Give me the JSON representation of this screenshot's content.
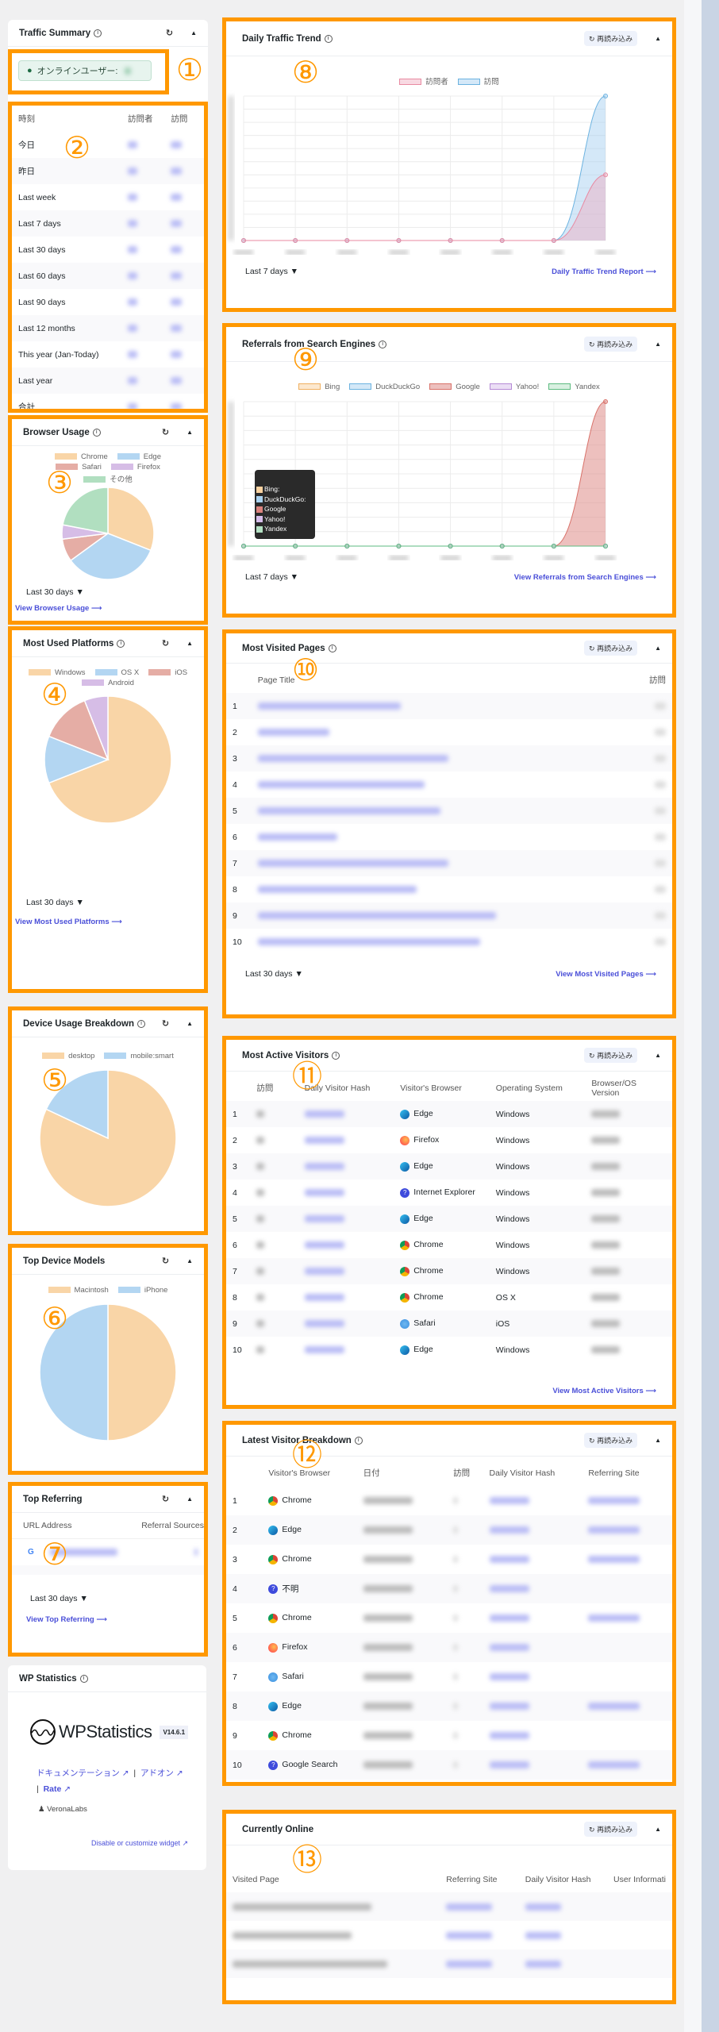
{
  "annotations": [
    "①",
    "②",
    "③",
    "④",
    "⑤",
    "⑥",
    "⑦",
    "⑧",
    "⑨",
    "⑩",
    "⑪",
    "⑫",
    "⑬"
  ],
  "reload_label": "再読み込み",
  "colors": {
    "annotation": "#ff9800",
    "link": "#4a4fd8",
    "chrome": "#f9d5a7",
    "edge": "#b3d6f2",
    "safari": "#e5ada5",
    "firefox": "#d6bde6",
    "other": "#b1dfc0"
  },
  "traffic_summary": {
    "title": "Traffic Summary",
    "online_label": "オンラインユーザー:",
    "columns": [
      "時刻",
      "訪問者",
      "訪問"
    ],
    "rows": [
      "今日",
      "昨日",
      "Last week",
      "Last 7 days",
      "Last 30 days",
      "Last 60 days",
      "Last 90 days",
      "Last 12 months",
      "This year (Jan-Today)",
      "Last year",
      "合計"
    ]
  },
  "browser_usage": {
    "title": "Browser Usage",
    "range": "Last 30 days",
    "link": "View Browser Usage"
  },
  "platforms": {
    "title": "Most Used Platforms",
    "range": "Last 30 days",
    "link": "View Most Used Platforms"
  },
  "device_usage": {
    "title": "Device Usage Breakdown"
  },
  "device_models": {
    "title": "Top Device Models"
  },
  "top_referring": {
    "title": "Top Referring",
    "columns": [
      "URL Address",
      "Referral Sources"
    ],
    "range": "Last 30 days",
    "link": "View Top Referring"
  },
  "wp_statistics": {
    "title": "WP Statistics",
    "logo": "WPStatistics",
    "version": "V14.6.1",
    "links": [
      "ドキュメンテーション",
      "アドオン",
      "Rate"
    ],
    "author": "VeronaLabs",
    "customize": "Disable or customize widget"
  },
  "daily_trend": {
    "title": "Daily Traffic Trend",
    "range": "Last 7 days",
    "link": "Daily Traffic Trend Report"
  },
  "search_engines": {
    "title": "Referrals from Search Engines",
    "range": "Last 7 days",
    "link": "View Referrals from Search Engines",
    "tooltip": [
      "Bing:",
      "DuckDuckGo:",
      "Google",
      "Yahoo!",
      "Yandex"
    ]
  },
  "most_visited": {
    "title": "Most Visited Pages",
    "columns": [
      "",
      "Page Title",
      "訪問"
    ],
    "rows": [
      "1",
      "2",
      "3",
      "4",
      "5",
      "6",
      "7",
      "8",
      "9",
      "10"
    ],
    "range": "Last 30 days",
    "link": "View Most Visited Pages"
  },
  "most_active": {
    "title": "Most Active Visitors",
    "columns": [
      "",
      "訪問",
      "Daily Visitor Hash",
      "Visitor's Browser",
      "Operating System",
      "Browser/OS Version"
    ],
    "rows": [
      {
        "n": "1",
        "browser": "Edge",
        "os": "Windows"
      },
      {
        "n": "2",
        "browser": "Firefox",
        "os": "Windows"
      },
      {
        "n": "3",
        "browser": "Edge",
        "os": "Windows"
      },
      {
        "n": "4",
        "browser": "Internet Explorer",
        "os": "Windows"
      },
      {
        "n": "5",
        "browser": "Edge",
        "os": "Windows"
      },
      {
        "n": "6",
        "browser": "Chrome",
        "os": "Windows"
      },
      {
        "n": "7",
        "browser": "Chrome",
        "os": "Windows"
      },
      {
        "n": "8",
        "browser": "Chrome",
        "os": "OS X"
      },
      {
        "n": "9",
        "browser": "Safari",
        "os": "iOS"
      },
      {
        "n": "10",
        "browser": "Edge",
        "os": "Windows"
      }
    ],
    "link": "View Most Active Visitors"
  },
  "latest_visitors": {
    "title": "Latest Visitor Breakdown",
    "columns": [
      "",
      "Visitor's Browser",
      "日付",
      "訪問",
      "Daily Visitor Hash",
      "Referring Site"
    ],
    "rows": [
      {
        "n": "1",
        "browser": "Chrome",
        "ref": true
      },
      {
        "n": "2",
        "browser": "Edge",
        "ref": true
      },
      {
        "n": "3",
        "browser": "Chrome",
        "ref": true
      },
      {
        "n": "4",
        "browser": "不明",
        "ref": false
      },
      {
        "n": "5",
        "browser": "Chrome",
        "ref": true
      },
      {
        "n": "6",
        "browser": "Firefox",
        "ref": false
      },
      {
        "n": "7",
        "browser": "Safari",
        "ref": false
      },
      {
        "n": "8",
        "browser": "Edge",
        "ref": true
      },
      {
        "n": "9",
        "browser": "Chrome",
        "ref": false
      },
      {
        "n": "10",
        "browser": "Google Search",
        "ref": true
      }
    ]
  },
  "currently_online": {
    "title": "Currently Online",
    "columns": [
      "Visited Page",
      "Referring Site",
      "Daily Visitor Hash",
      "User Informati"
    ],
    "row_count": 3
  },
  "chart_data": [
    {
      "type": "pie",
      "id": "browser",
      "labels": [
        "Chrome",
        "Edge",
        "Safari",
        "Firefox",
        "その他"
      ],
      "values": [
        31,
        34,
        8,
        5,
        22
      ],
      "colors": [
        "#f9d5a7",
        "#b3d6f2",
        "#e5ada5",
        "#d6bde6",
        "#b1dfc0"
      ]
    },
    {
      "type": "pie",
      "id": "platform",
      "labels": [
        "Windows",
        "OS X",
        "iOS",
        "Android"
      ],
      "values": [
        69,
        12,
        13,
        6
      ],
      "colors": [
        "#f9d5a7",
        "#b3d6f2",
        "#e5ada5",
        "#d6bde6"
      ]
    },
    {
      "type": "pie",
      "id": "device",
      "labels": [
        "desktop",
        "mobile:smart"
      ],
      "values": [
        82,
        18
      ],
      "colors": [
        "#f9d5a7",
        "#b3d6f2"
      ]
    },
    {
      "type": "pie",
      "id": "models",
      "labels": [
        "Macintosh",
        "iPhone"
      ],
      "values": [
        50,
        50
      ],
      "colors": [
        "#f9d5a7",
        "#b3d6f2"
      ]
    },
    {
      "type": "area",
      "id": "trend",
      "series": [
        {
          "name": "訪問者",
          "values": [
            0,
            0,
            0,
            0,
            0,
            0,
            0,
            5
          ],
          "color": "#e88aa2",
          "fill": "rgba(240,170,190,0.45)"
        },
        {
          "name": "訪問",
          "values": [
            0,
            0,
            0,
            0,
            0,
            0,
            0,
            11
          ],
          "color": "#6cb3e0",
          "fill": "rgba(160,205,240,0.45)"
        }
      ],
      "ylim": [
        0,
        11
      ],
      "points": 8
    },
    {
      "type": "area",
      "id": "engines",
      "series": [
        {
          "name": "Bing",
          "values": [
            0,
            0,
            0,
            0,
            0,
            0,
            0,
            0
          ],
          "color": "#f0b060",
          "fill": "rgba(250,210,160,0.5)"
        },
        {
          "name": "DuckDuckGo",
          "values": [
            0,
            0,
            0,
            0,
            0,
            0,
            0,
            0
          ],
          "color": "#6cb3e0",
          "fill": "rgba(170,210,240,0.5)"
        },
        {
          "name": "Google",
          "values": [
            0,
            0,
            0,
            0,
            0,
            0,
            0,
            10
          ],
          "color": "#d9726a",
          "fill": "rgba(220,130,125,0.5)"
        },
        {
          "name": "Yahoo!",
          "values": [
            0,
            0,
            0,
            0,
            0,
            0,
            0,
            0
          ],
          "color": "#b58ad6",
          "fill": "rgba(215,190,235,0.5)"
        },
        {
          "name": "Yandex",
          "values": [
            0,
            0,
            0,
            0,
            0,
            0,
            0,
            0
          ],
          "color": "#5dbb80",
          "fill": "rgba(180,225,195,0.5)"
        }
      ],
      "ylim": [
        0,
        10
      ],
      "points": 8
    }
  ]
}
